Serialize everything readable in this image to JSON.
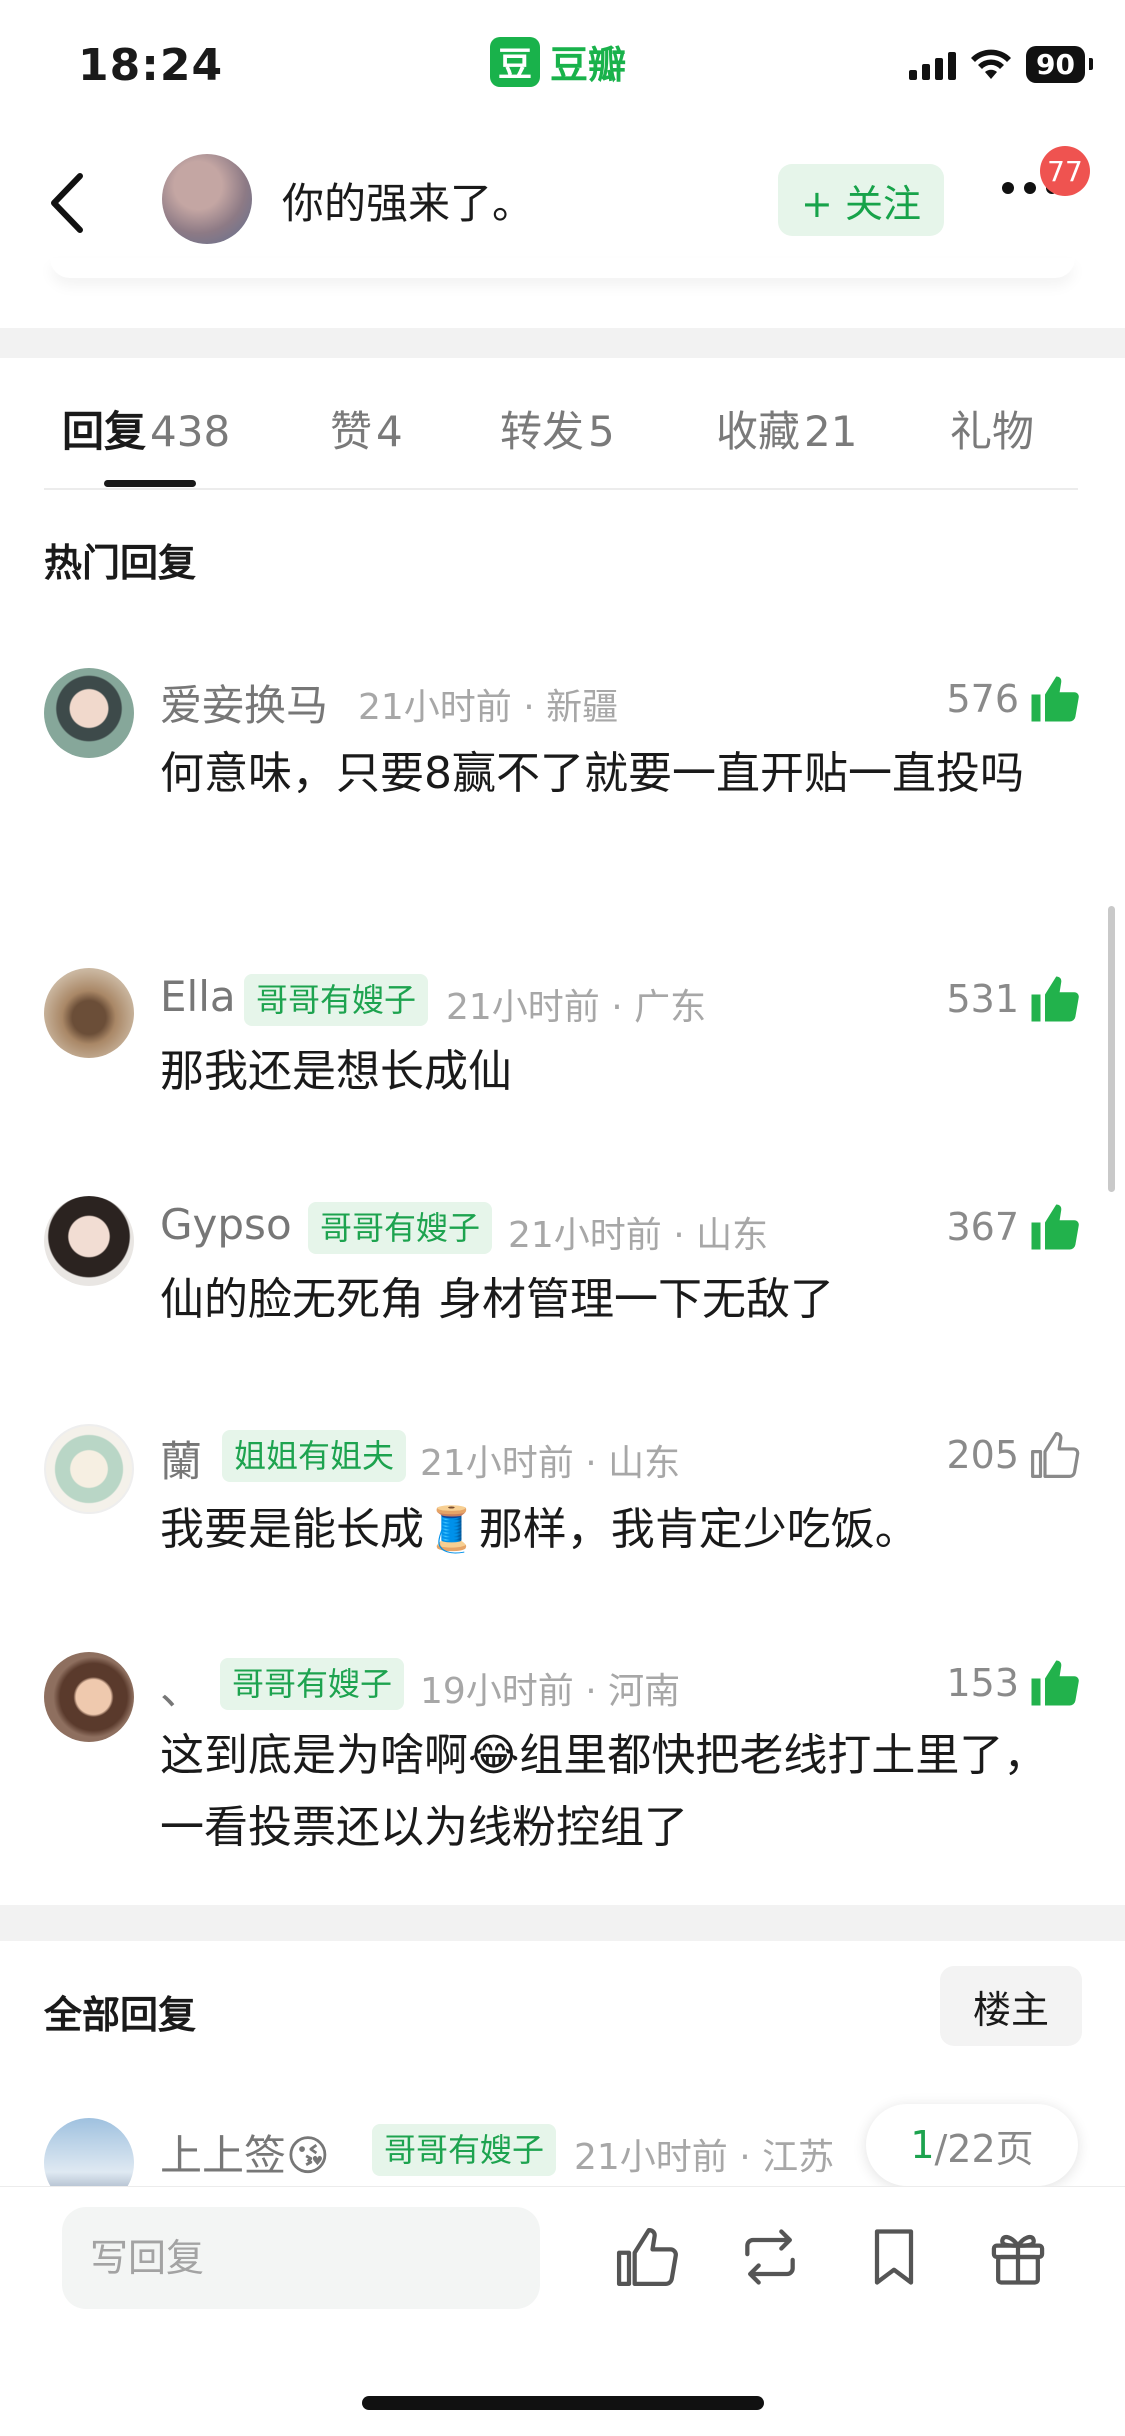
{
  "status_bar": {
    "time": "18:24",
    "brand_logo": "豆",
    "brand_name": "豆瓣",
    "battery": "90"
  },
  "header": {
    "title": "你的强来了。",
    "follow_label": "+ 关注",
    "notification_count": "77"
  },
  "tabs": [
    {
      "label": "回复",
      "count": "438",
      "active": true
    },
    {
      "label": "赞",
      "count": "4"
    },
    {
      "label": "转发",
      "count": "5"
    },
    {
      "label": "收藏",
      "count": "21"
    },
    {
      "label": "礼物",
      "count": ""
    }
  ],
  "hot_section": {
    "title": "热门回复"
  },
  "hot_comments": [
    {
      "name": "爱妾换马",
      "tag": "",
      "meta": "21小时前 · 新疆",
      "likes": "576",
      "liked": true,
      "text": "何意味，只要8赢不了就要一直开贴一直投吗"
    },
    {
      "name": "Ella",
      "tag": "哥哥有嫂子",
      "meta": "21小时前 · 广东",
      "likes": "531",
      "liked": true,
      "text": "那我还是想长成仙"
    },
    {
      "name": "Gypso",
      "tag": "哥哥有嫂子",
      "meta": "21小时前 · 山东",
      "likes": "367",
      "liked": true,
      "text": "仙的脸无死角 身材管理一下无敌了"
    },
    {
      "name": "蘭",
      "tag": "姐姐有姐夫",
      "meta": "21小时前 · 山东",
      "likes": "205",
      "liked": false,
      "text": "我要是能长成🧵那样，我肯定少吃饭。"
    },
    {
      "name": "、",
      "tag": "哥哥有嫂子",
      "meta": "19小时前 · 河南",
      "likes": "153",
      "liked": true,
      "text": "这到底是为啥啊😂组里都快把老线打土里了，一看投票还以为线粉控组了"
    }
  ],
  "all_section": {
    "title": "全部回复",
    "owner_filter": "楼主"
  },
  "all_comments": [
    {
      "name": "上上签😘",
      "tag": "哥哥有嫂子",
      "meta": "21小时前 · 江苏"
    }
  ],
  "pagination": {
    "current": "1",
    "total": "/22页"
  },
  "bottom_bar": {
    "reply_placeholder": "写回复"
  },
  "colors": {
    "accent_green": "#19b24b",
    "tag_bg": "#e6f5ea",
    "badge_red": "#ef5350"
  },
  "icons": [
    "back-icon",
    "more-icon",
    "thumbs-up-icon",
    "repost-icon",
    "bookmark-icon",
    "gift-icon"
  ]
}
